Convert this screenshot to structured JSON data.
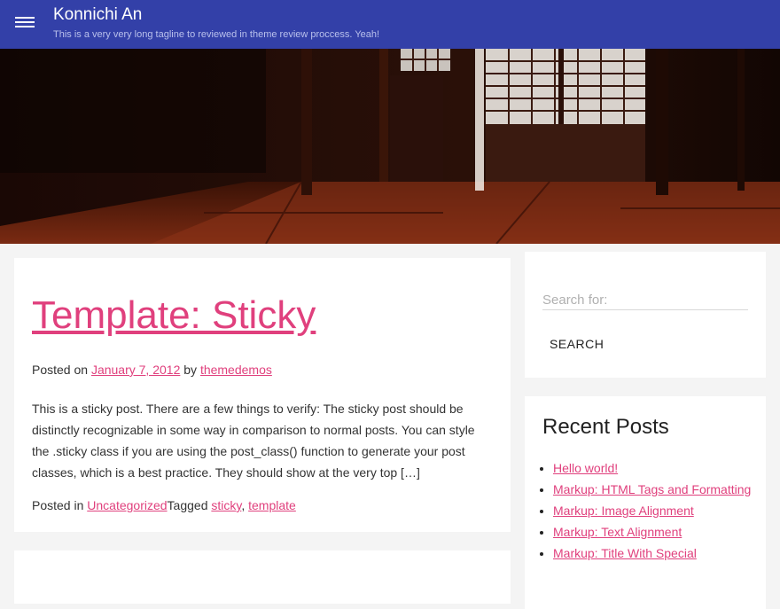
{
  "header": {
    "site_title": "Konnichi An",
    "tagline": "This is a very very long tagline to reviewed in theme review proccess. Yeah!"
  },
  "post": {
    "title": "Template: Sticky",
    "posted_on_label": "Posted on",
    "date": "January 7, 2012",
    "by_label": "by",
    "author": "themedemos",
    "excerpt": "This is a sticky post. There are a few things to verify: The sticky post should be distinctly recognizable in some way in comparison to normal posts. You can style the .sticky class if you are using the post_class() function to generate your post classes, which is a best practice. They should show at the very top […]",
    "posted_in_label": "Posted in",
    "category": "Uncategorized",
    "tagged_label": "Tagged",
    "tags": [
      "sticky",
      "template"
    ],
    "tag_separator": ", "
  },
  "sidebar": {
    "search_placeholder": "Search for:",
    "search_button": "SEARCH",
    "recent_title": "Recent Posts",
    "recent_posts": [
      "Hello world!",
      "Markup: HTML Tags and Formatting",
      "Markup: Image Alignment",
      "Markup: Text Alignment",
      "Markup: Title With Special"
    ]
  },
  "colors": {
    "header_bg": "#3340a8",
    "link": "#e0407d"
  }
}
